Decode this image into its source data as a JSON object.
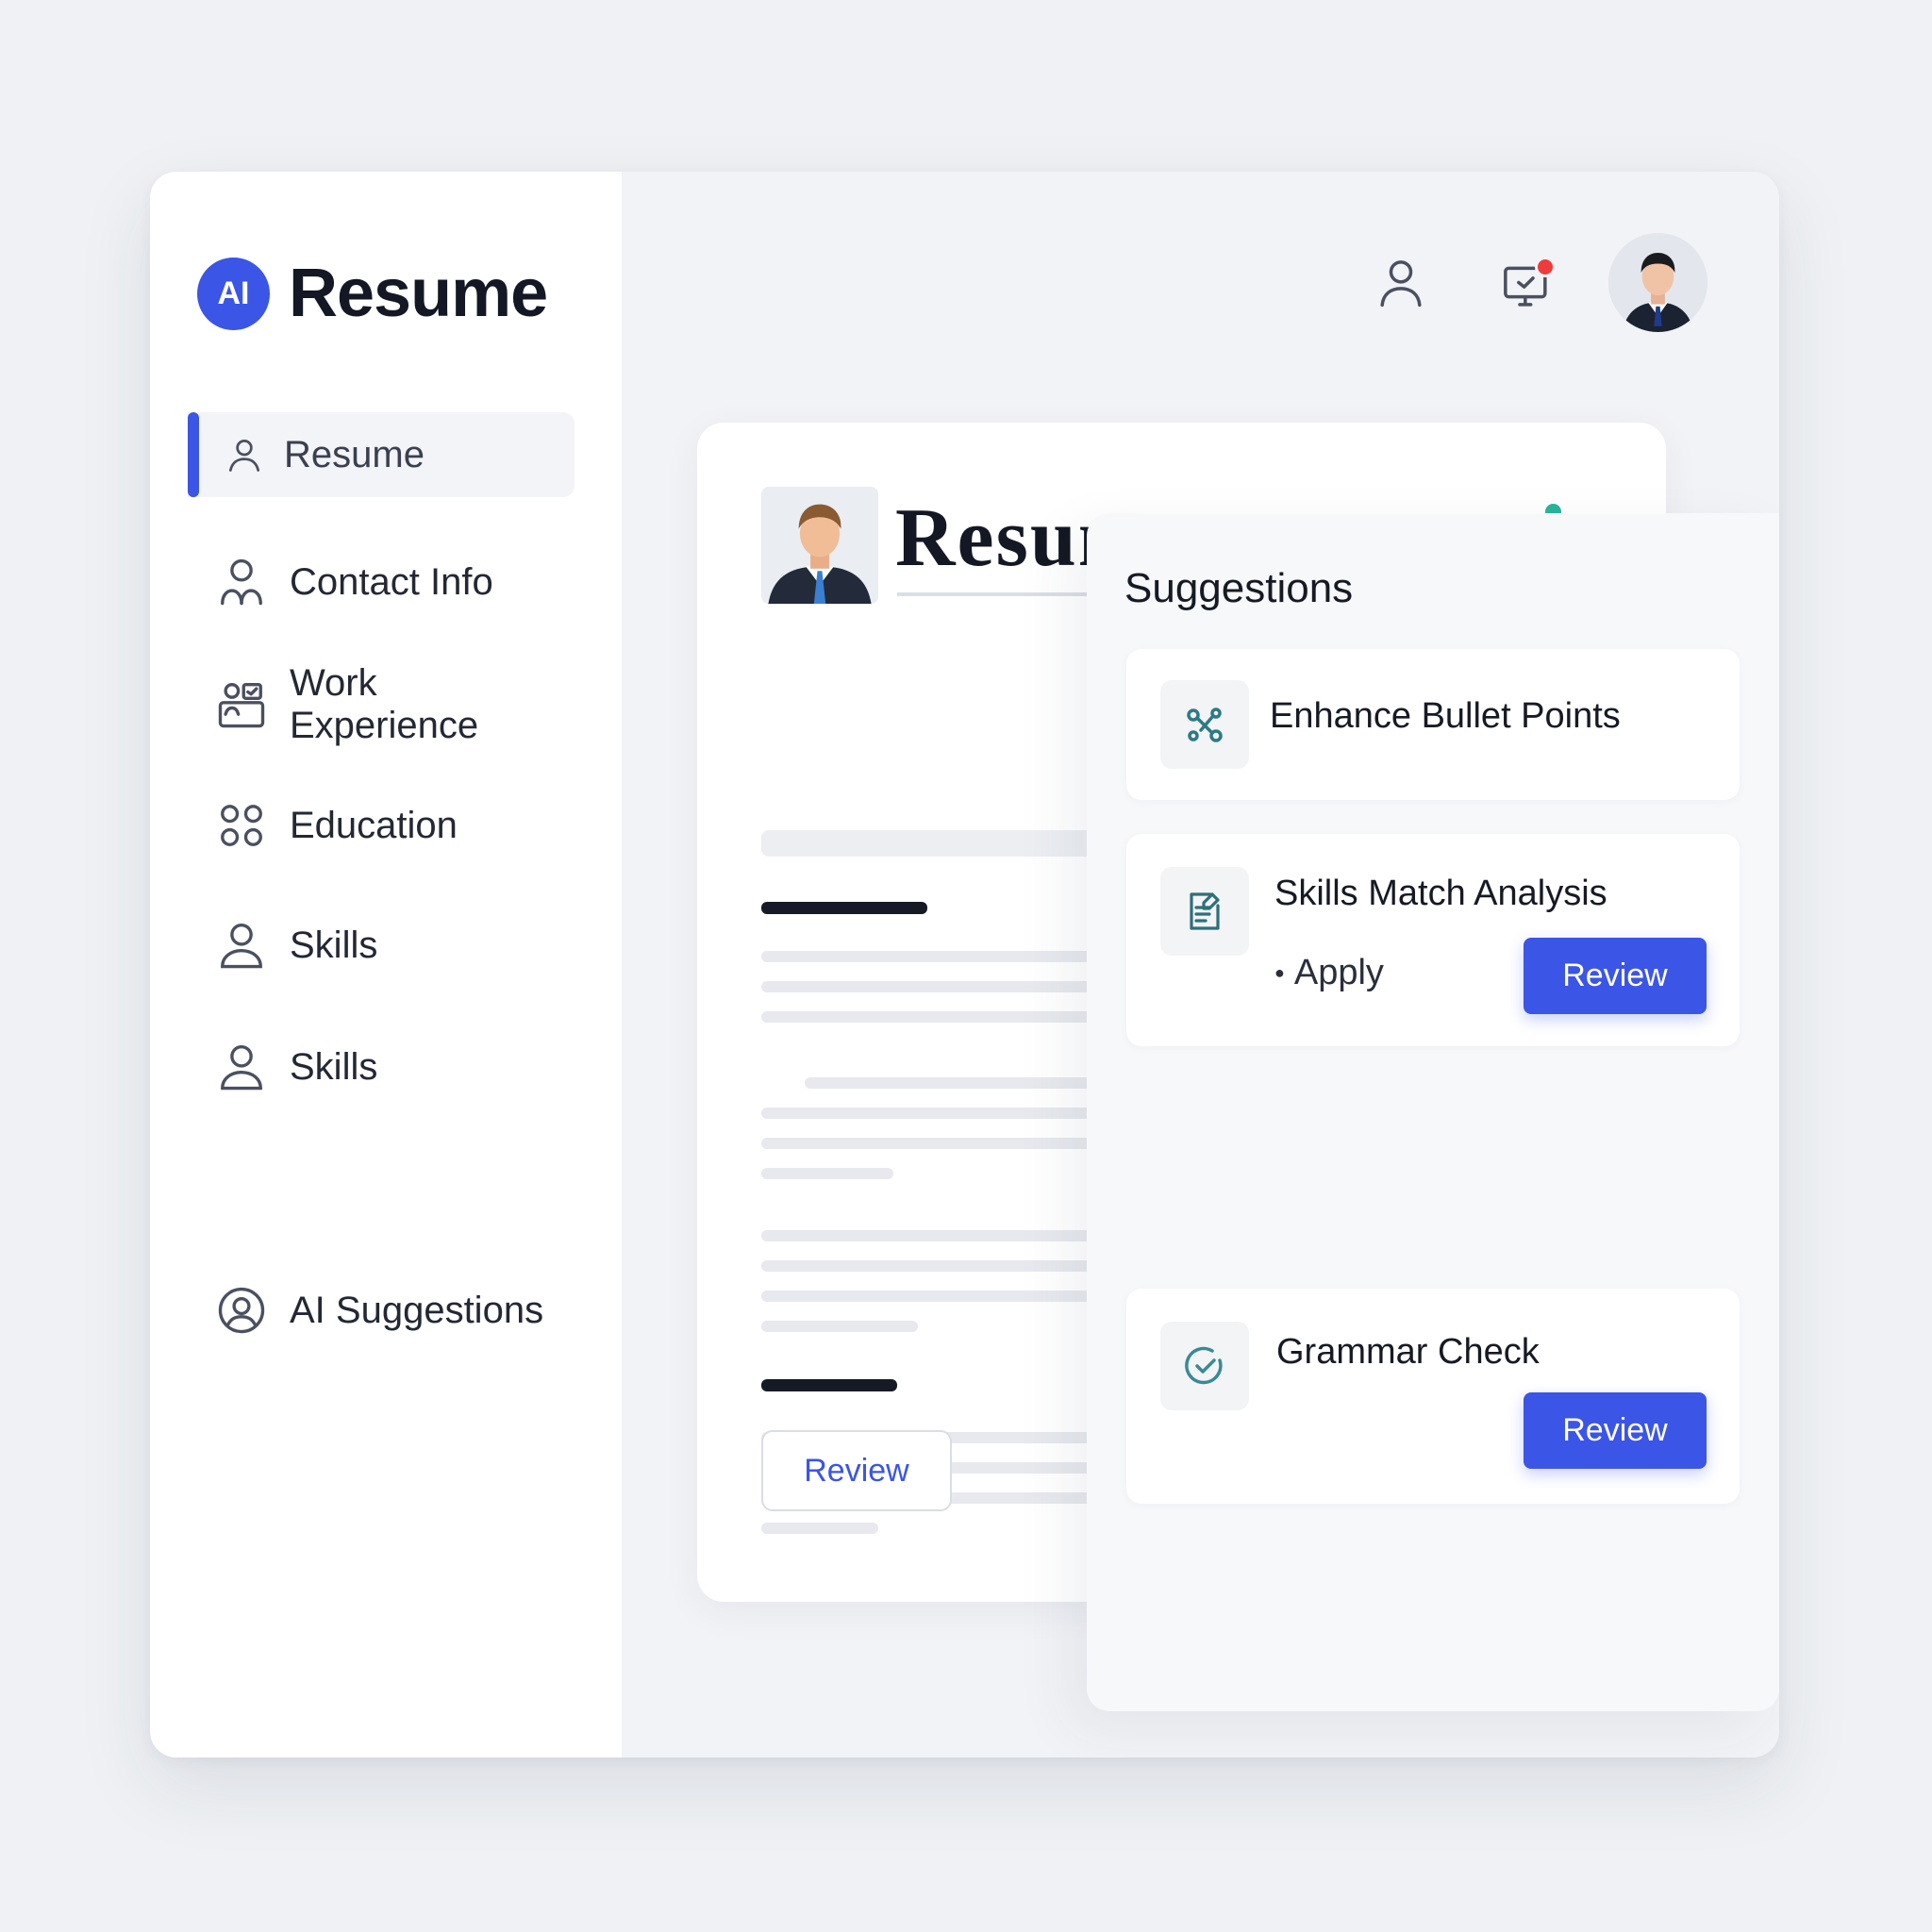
{
  "app": {
    "logo_badge": "AI",
    "logo_text": "Resume"
  },
  "sidebar": {
    "items": [
      {
        "label": "Resume",
        "icon": "user-icon",
        "active": true
      },
      {
        "label": "Contact Info",
        "icon": "contacts-icon"
      },
      {
        "label": "Work Experience",
        "icon": "briefcase-users-icon"
      },
      {
        "label": "Education",
        "icon": "circles-grid-icon"
      },
      {
        "label": "Skills",
        "icon": "user-icon"
      },
      {
        "label": "Skills",
        "icon": "user-icon"
      },
      {
        "label": "AI Suggestions",
        "icon": "user-circle-icon"
      }
    ]
  },
  "header": {
    "icons": [
      "profile-icon",
      "notification-monitor-icon",
      "avatar"
    ]
  },
  "document": {
    "title": "Resume",
    "review_label": "Review"
  },
  "suggestions": {
    "title": "Suggestions",
    "cards": [
      {
        "label": "Enhance Bullet Points",
        "icon": "nodes-icon"
      },
      {
        "label": "Skills Match Analysis",
        "icon": "document-edit-icon",
        "apply_label": "Apply",
        "review_label": "Review"
      },
      {
        "label": "Grammar Check",
        "icon": "check-circle-icon",
        "review_label": "Review"
      }
    ]
  },
  "colors": {
    "accent": "#3b55e6",
    "status": "#2bb59a",
    "notification": "#ef3b3b"
  }
}
